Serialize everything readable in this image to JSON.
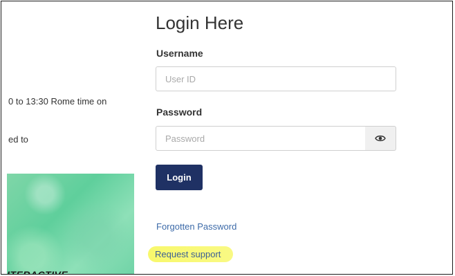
{
  "left_panel": {
    "text_line_1": "0 to 13:30 Rome time on",
    "text_line_2": "ed to",
    "promo_label": "ITERACTIVE"
  },
  "login": {
    "title": "Login Here",
    "username_label": "Username",
    "username_placeholder": "User ID",
    "password_label": "Password",
    "password_placeholder": "Password",
    "show_password_icon": "eye-icon",
    "login_button": "Login",
    "forgot_link": "Forgotten Password",
    "support_link": "Request support"
  },
  "colors": {
    "login_button": "#1f3164",
    "link": "#3c6aa8",
    "highlight": "#f8f864",
    "promo_green": "#6fd3a6"
  }
}
